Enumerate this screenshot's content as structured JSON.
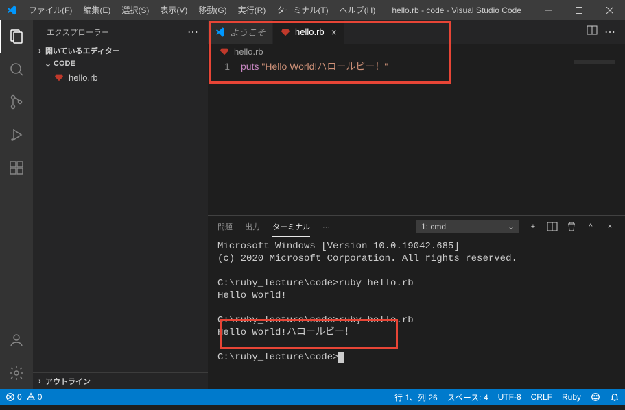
{
  "titlebar": {
    "menus": [
      "ファイル(F)",
      "編集(E)",
      "選択(S)",
      "表示(V)",
      "移動(G)",
      "実行(R)",
      "ターミナル(T)",
      "ヘルプ(H)"
    ],
    "title": "hello.rb - code - Visual Studio Code"
  },
  "sidebar": {
    "title": "エクスプローラー",
    "open_editors": "開いているエディター",
    "folder": "CODE",
    "file": "hello.rb",
    "outline": "アウトライン"
  },
  "tabs": {
    "welcome": "ようこそ",
    "file": "hello.rb"
  },
  "breadcrumb": {
    "file": "hello.rb"
  },
  "code": {
    "line_no": "1",
    "keyword": "puts",
    "string": "\"Hello World!ハロールビー！\""
  },
  "panel": {
    "tabs": {
      "problems": "問題",
      "output": "出力",
      "terminal": "ターミナル"
    },
    "select": "1: cmd",
    "terminal_lines": [
      "Microsoft Windows [Version 10.0.19042.685]",
      "(c) 2020 Microsoft Corporation. All rights reserved.",
      "",
      "C:\\ruby_lecture\\code>ruby hello.rb",
      "Hello World!",
      "",
      "C:\\ruby_lecture\\code>ruby hello.rb",
      "Hello World!ハロールビー！",
      "",
      "C:\\ruby_lecture\\code>"
    ]
  },
  "status": {
    "errors": "0",
    "warnings": "0",
    "ln_col": "行 1、列 26",
    "spaces": "スペース: 4",
    "encoding": "UTF-8",
    "eol": "CRLF",
    "lang": "Ruby"
  }
}
